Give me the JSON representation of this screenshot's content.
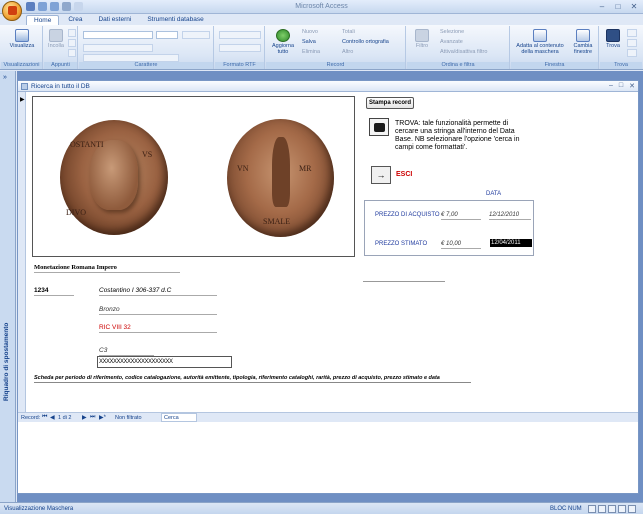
{
  "app": {
    "title": "Microsoft Access",
    "window_controls": [
      "–",
      "□",
      "✕"
    ]
  },
  "ribbon": {
    "tabs": [
      "Home",
      "Crea",
      "Dati esterni",
      "Strumenti database"
    ],
    "active_tab": "Home",
    "groups": {
      "visualizzazioni": {
        "label": "Visualizzazioni",
        "btn": "Visualizza"
      },
      "appunti": {
        "label": "Appunti",
        "btn": "Incolla"
      },
      "carattere": {
        "label": "Carattere"
      },
      "formato_rtf": {
        "label": "Formato RTF"
      },
      "record": {
        "label": "Record",
        "aggiorna": "Aggiorna tutto",
        "nuovo": "Nuovo",
        "salva": "Salva",
        "elimina": "Elimina",
        "totali": "Totali",
        "controllo": "Controllo ortografia",
        "altro": "Altro"
      },
      "ordina": {
        "label": "Ordina e filtra",
        "filtro": "Filtro",
        "selezione": "Selezione",
        "avanzate": "Avanzate",
        "attiva": "Attiva/disattiva filtro"
      },
      "finestra": {
        "label": "Finestra",
        "adatta": "Adatta al contenuto della maschera",
        "cambia": "Cambia finestre"
      },
      "trova": {
        "label": "Trova",
        "btn": "Trova"
      }
    }
  },
  "nav_pane": {
    "label": "Riquadro di spostamento",
    "toggle": "»"
  },
  "form": {
    "title": "Ricerca in tutto il DB",
    "coin_legends": {
      "left_a": "DIVO",
      "left_b": "OSTANTI",
      "left_c": "VS",
      "right_a": "VN",
      "right_b": "MR",
      "right_c": "SMALE"
    },
    "stampa_button": "Stampa record",
    "trova_text": "TROVA: tale funzionalità permette di cercare una stringa all'interno del Data Base. NB selezionare l'opzione 'cerca in campi come formattati'.",
    "esci_label": "ESCI",
    "esci_icon": "→",
    "data_header": "DATA",
    "prezzo_acquisto": {
      "label": "PREZZO DI ACQUISTO",
      "value": "€ 7,00",
      "date": "12/12/2010"
    },
    "prezzo_stimato": {
      "label": "PREZZO STIMATO",
      "value": "€ 10,00",
      "date": "12/04/2011"
    },
    "monetazione": "Monetazione Romana Impero",
    "numero": "1234",
    "emittente": "Costantino I 306-337 d.C",
    "materiale": "Bronzo",
    "catalogo": "RIC VIII 32",
    "rarita": "C3",
    "pattern": "XXXXXXXXXXXXXXXXXXXXX",
    "scheda": "Scheda per periodo di riferimento, codice catalogazione, autorità emittente, tipologia, riferimento cataloghi, rarità, prezzo di acquisto, prezzo stimato e data"
  },
  "record_nav": {
    "label": "Record:",
    "first": "⏮",
    "prev": "◀",
    "count": "1 di 2",
    "next": "▶",
    "last": "⏭",
    "new": "▶*",
    "filter": "Non filtrato",
    "search": "Cerca"
  },
  "status": {
    "left": "Visualizzazione Maschera",
    "right": "BLOC NUM"
  },
  "colors": {
    "accent": "#15428b",
    "workspace": "#6f8fc3",
    "esci": "#cc0000",
    "price_label": "#1f3a9e"
  }
}
